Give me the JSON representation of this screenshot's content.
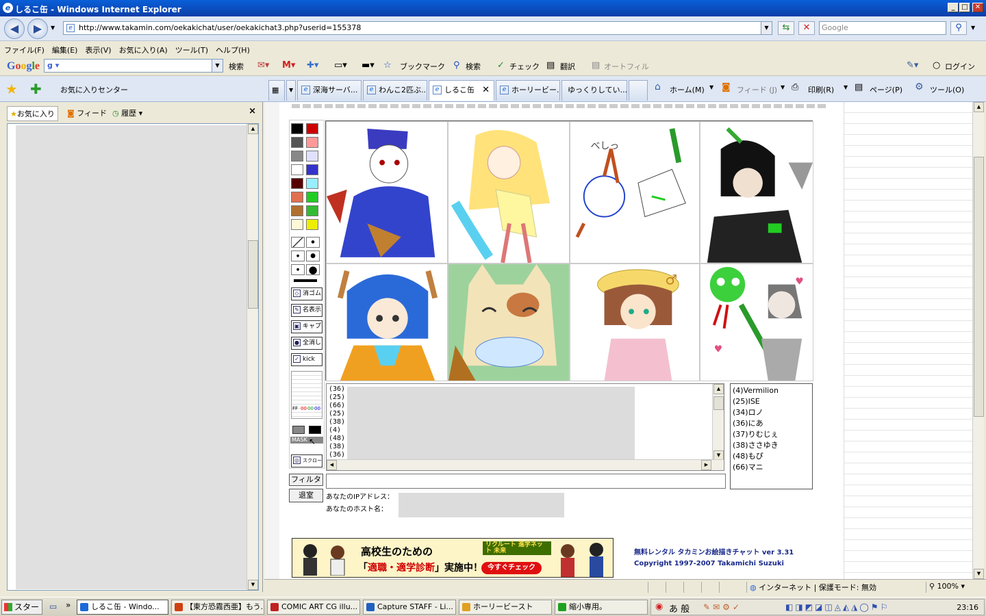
{
  "window": {
    "title": "しるこ缶 - Windows Internet Explorer",
    "min": "_",
    "max": "□",
    "close": "✕"
  },
  "address": {
    "url": "http://www.takamin.com/oekakichat/user/oekakichat3.php?userid=155378",
    "search_placeholder": "Google"
  },
  "menu": [
    "ファイル(F)",
    "編集(E)",
    "表示(V)",
    "お気に入り(A)",
    "ツール(T)",
    "ヘルプ(H)"
  ],
  "google_toolbar": {
    "logo": "Google",
    "search_label": "検索",
    "bookmarks": "ブックマーク",
    "search2": "検索",
    "check": "チェック",
    "translate": "翻訳",
    "autofill": "オートフィル",
    "login": "ログイン"
  },
  "favorites_center": "お気に入りセンター",
  "tabs": [
    {
      "label": "深海サーバ..."
    },
    {
      "label": "わんこ2匹ぶ..."
    },
    {
      "label": "しるこ缶",
      "active": true
    },
    {
      "label": "ホーリービー..."
    },
    {
      "label": "ゆっくりしてい..."
    }
  ],
  "commands": {
    "home": "ホーム(M)",
    "feed": "フィード (J)",
    "print": "印刷(R)",
    "page": "ページ(P)",
    "tools": "ツール(O)"
  },
  "favpane": {
    "favorites": "お気に入り",
    "feeds": "フィード",
    "history": "履歴",
    "close": "×"
  },
  "palette": {
    "colors": [
      "#000000",
      "#cc0000",
      "#555555",
      "#ff9999",
      "#888888",
      "#e0e0ff",
      "#ffffff",
      "#3333cc",
      "#550000",
      "#99eeff",
      "#e07050",
      "#22cc22",
      "#b07030",
      "#33bb33",
      "#fff8d8",
      "#eeee00"
    ],
    "tools": [
      {
        "icon": "eraser-icon",
        "glyph": "◇",
        "label": "消ゴム"
      },
      {
        "icon": "name-icon",
        "glyph": "✎",
        "label": "名表示"
      },
      {
        "icon": "camera-icon",
        "glyph": "▣",
        "label": "キャプ"
      },
      {
        "icon": "bomb-icon",
        "glyph": "●",
        "label": "全消し"
      },
      {
        "icon": "kick-icon",
        "glyph": "✓",
        "label": "kick"
      }
    ],
    "ff_label": "FF",
    "rgb_values": [
      "00",
      "00",
      "00"
    ],
    "mask_label": "MASK",
    "scroll_label": "スクロール"
  },
  "chat": {
    "lines": [
      "(36)",
      "(25)",
      "(66)",
      "(25)",
      "(38)",
      "(4)",
      "(48)",
      "(38)",
      "(36)"
    ]
  },
  "users": [
    "(4)Vermilion",
    "(25)ISE",
    "(34)ロノ",
    "(36)にあ",
    "(37)りむじぇ",
    "(38)ささゆき",
    "(48)もぴ",
    "(66)マニ"
  ],
  "form": {
    "filter": "フィルタ",
    "leave": "退室",
    "ip_label": "あなたのIPアドレス：",
    "host_label": "あなたのホスト名："
  },
  "banner": {
    "line1": "高校生のための",
    "line2a": "「",
    "line2b": "適職・適学診断",
    "line2c": "」実施中！",
    "brand": "リクルート 進学ネット 未来",
    "cta": "今すぐチェック"
  },
  "copyright": {
    "line1": "無料レンタル タカミンお絵描きチャット ver 3.31",
    "line2": "Copyright 1997-2007 Takamichi Suzuki"
  },
  "status": {
    "zone": "インターネット | 保護モード: 無効",
    "zoom": "100%"
  },
  "taskbar": {
    "start": "スタート",
    "tasks": [
      {
        "label": "しるこ缶 - Windo...",
        "active": true,
        "color": "#1a6ad8"
      },
      {
        "label": "【東方恐霧西亜】もう...",
        "color": "#d04010"
      },
      {
        "label": "COMIC ART CG illu...",
        "color": "#c02020"
      },
      {
        "label": "Capture STAFF - Li...",
        "color": "#2060c0"
      },
      {
        "label": "ホーリービースト",
        "color": "#e0a020"
      },
      {
        "label": "縮小専用。",
        "color": "#20a020"
      }
    ],
    "ime": "あ 般",
    "clock": "23:16"
  }
}
